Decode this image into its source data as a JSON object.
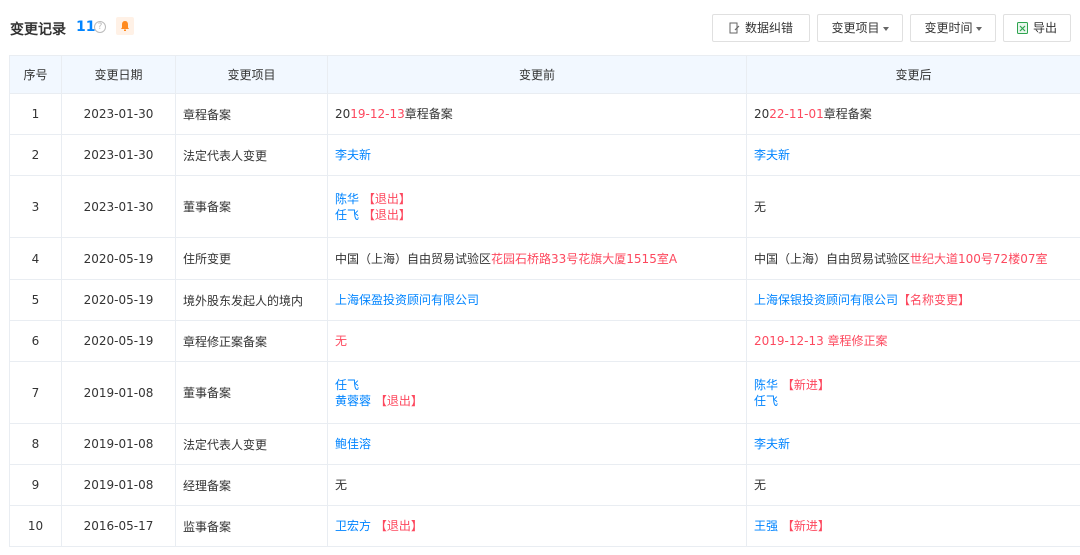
{
  "header": {
    "title": "变更记录",
    "count": "11",
    "help_glyph": "?",
    "buttons": {
      "correct": "数据纠错",
      "item": "变更项目",
      "time": "变更时间",
      "export": "导出"
    }
  },
  "columns": [
    "序号",
    "变更日期",
    "变更项目",
    "变更前",
    "变更后"
  ],
  "rows": [
    {
      "idx": "1",
      "date": "2023-01-30",
      "item": "章程备案",
      "before": [
        [
          {
            "t": "20",
            "c": "dark"
          },
          {
            "t": "19-12-13",
            "c": "red"
          },
          {
            "t": "章程备案",
            "c": "dark"
          }
        ]
      ],
      "after": [
        [
          {
            "t": "20",
            "c": "dark"
          },
          {
            "t": "22-11-01",
            "c": "red"
          },
          {
            "t": "章程备案",
            "c": "dark"
          }
        ]
      ]
    },
    {
      "idx": "2",
      "date": "2023-01-30",
      "item": "法定代表人变更",
      "before": [
        [
          {
            "t": "李夫新",
            "c": "blue"
          }
        ]
      ],
      "after": [
        [
          {
            "t": "李夫新",
            "c": "blue"
          }
        ]
      ]
    },
    {
      "idx": "3",
      "date": "2023-01-30",
      "item": "董事备案",
      "before": [
        [
          {
            "t": "陈华",
            "c": "blue"
          },
          {
            "t": " 【退出】",
            "c": "red"
          }
        ],
        [
          {
            "t": "任飞",
            "c": "blue"
          },
          {
            "t": " 【退出】",
            "c": "red"
          }
        ]
      ],
      "after": [
        [
          {
            "t": "无",
            "c": "dark"
          }
        ]
      ]
    },
    {
      "idx": "4",
      "date": "2020-05-19",
      "item": "住所变更",
      "before": [
        [
          {
            "t": "中国（上海）自由贸易试验区",
            "c": "dark"
          },
          {
            "t": "花园石桥路33号花旗大厦1515室A",
            "c": "red"
          }
        ]
      ],
      "after": [
        [
          {
            "t": "中国（上海）自由贸易试验区",
            "c": "dark"
          },
          {
            "t": "世纪大道100号72楼07室",
            "c": "red"
          }
        ]
      ]
    },
    {
      "idx": "5",
      "date": "2020-05-19",
      "item": "境外股东发起人的境内",
      "before": [
        [
          {
            "t": "上海保盈投资顾问有限公司",
            "c": "blue"
          }
        ]
      ],
      "after": [
        [
          {
            "t": "上海保银投资顾问有限公司",
            "c": "blue"
          },
          {
            "t": "【名称变更】",
            "c": "red"
          }
        ]
      ]
    },
    {
      "idx": "6",
      "date": "2020-05-19",
      "item": "章程修正案备案",
      "before": [
        [
          {
            "t": "无",
            "c": "red"
          }
        ]
      ],
      "after": [
        [
          {
            "t": "2019-12-13 章程修正案",
            "c": "red"
          }
        ]
      ]
    },
    {
      "idx": "7",
      "date": "2019-01-08",
      "item": "董事备案",
      "before": [
        [
          {
            "t": "任飞",
            "c": "blue"
          }
        ],
        [
          {
            "t": "黄蓉蓉",
            "c": "blue"
          },
          {
            "t": " 【退出】",
            "c": "red"
          }
        ]
      ],
      "after": [
        [
          {
            "t": "陈华",
            "c": "blue"
          },
          {
            "t": " 【新进】",
            "c": "red"
          }
        ],
        [
          {
            "t": "任飞",
            "c": "blue"
          }
        ]
      ]
    },
    {
      "idx": "8",
      "date": "2019-01-08",
      "item": "法定代表人变更",
      "before": [
        [
          {
            "t": "鲍佳溶",
            "c": "blue"
          }
        ]
      ],
      "after": [
        [
          {
            "t": "李夫新",
            "c": "blue"
          }
        ]
      ]
    },
    {
      "idx": "9",
      "date": "2019-01-08",
      "item": "经理备案",
      "before": [
        [
          {
            "t": "无",
            "c": "dark"
          }
        ]
      ],
      "after": [
        [
          {
            "t": "无",
            "c": "dark"
          }
        ]
      ]
    },
    {
      "idx": "10",
      "date": "2016-05-17",
      "item": "监事备案",
      "before": [
        [
          {
            "t": "卫宏方",
            "c": "blue"
          },
          {
            "t": " 【退出】",
            "c": "red"
          }
        ]
      ],
      "after": [
        [
          {
            "t": "王强",
            "c": "blue"
          },
          {
            "t": " 【新进】",
            "c": "red"
          }
        ]
      ]
    }
  ],
  "colors": {
    "accent": "#0084ff",
    "highlight": "#fd485e",
    "header_bg": "#f2f8ff",
    "border": "#e9edf2"
  }
}
